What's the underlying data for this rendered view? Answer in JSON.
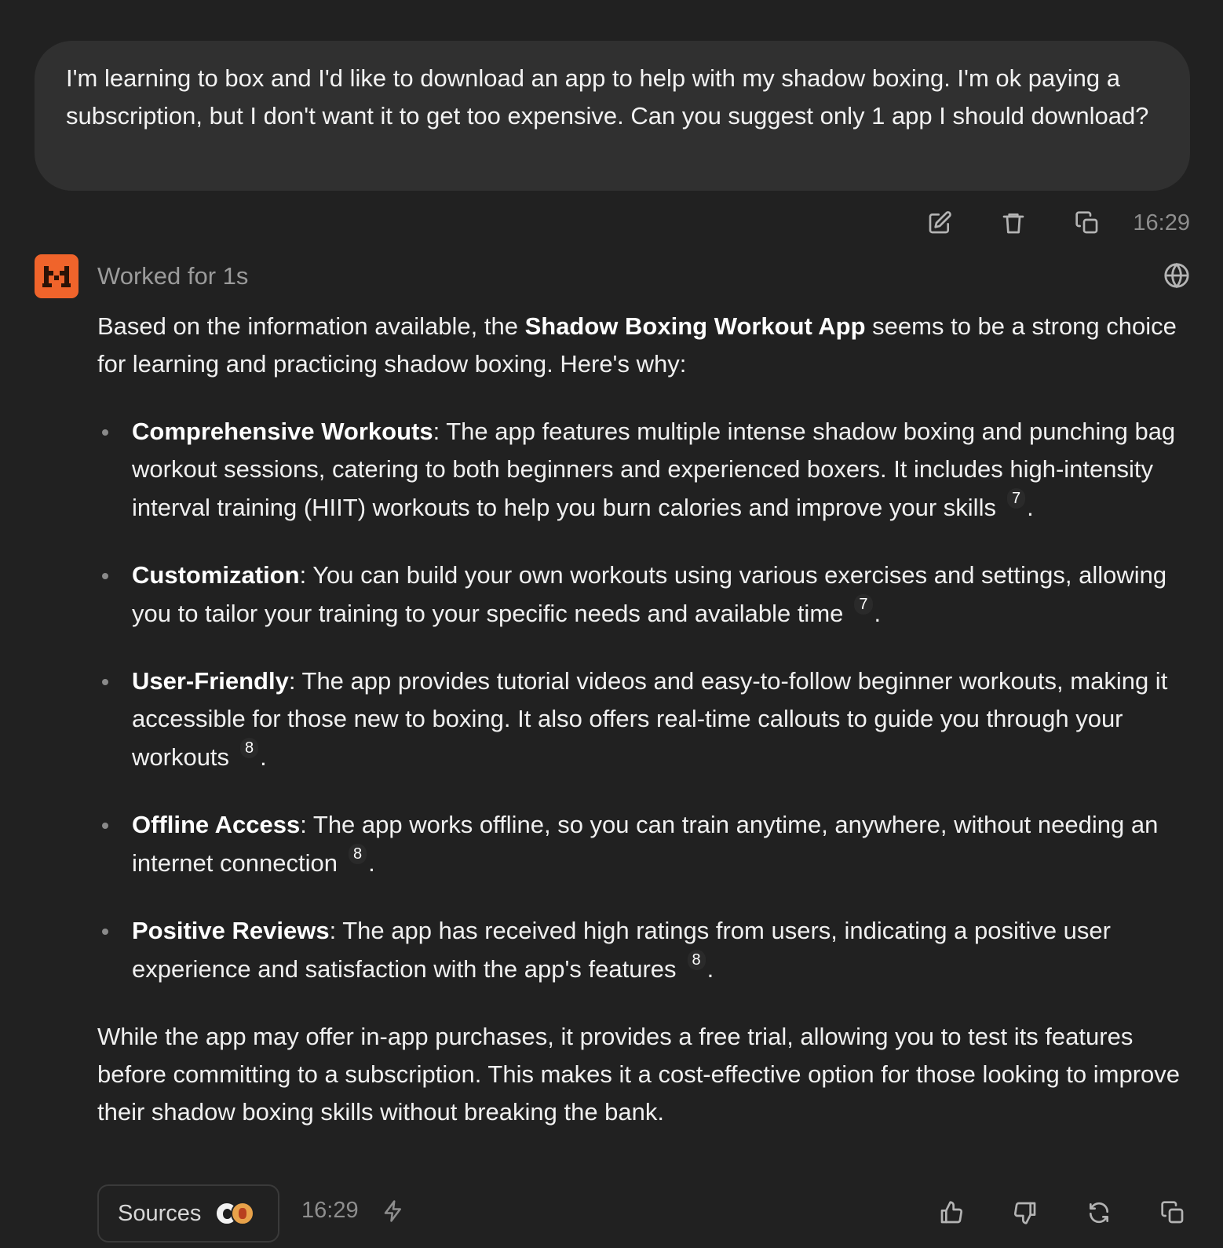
{
  "user_message": {
    "text": "I'm learning to box and I'd like to download an app to help with my shadow boxing. I'm ok paying a subscription, but I don't want it to get too expensive. Can you suggest only 1 app I should download?",
    "timestamp": "16:29",
    "actions": [
      "edit-icon",
      "trash-icon",
      "copy-icon"
    ]
  },
  "assistant": {
    "status": "Worked for 1s",
    "intro_before": "Based on the information available, the ",
    "intro_bold": "Shadow Boxing Workout App",
    "intro_after": " seems to be a strong choice for learning and practicing shadow boxing. Here's why:",
    "bullets": [
      {
        "title": "Comprehensive Workouts",
        "text": ": The app features multiple intense shadow boxing and punching bag workout sessions, catering to both beginners and experienced boxers. It includes high-intensity interval training (HIIT) workouts to help you burn calories and improve your skills",
        "cite": "7"
      },
      {
        "title": "Customization",
        "text": ": You can build your own workouts using various exercises and settings, allowing you to tailor your training to your specific needs and available time",
        "cite": "7"
      },
      {
        "title": "User-Friendly",
        "text": ": The app provides tutorial videos and easy-to-follow beginner workouts, making it accessible for those new to boxing. It also offers real-time callouts to guide you through your workouts",
        "cite": "8"
      },
      {
        "title": "Offline Access",
        "text": ": The app works offline, so you can train anytime, anywhere, without needing an internet connection",
        "cite": "8"
      },
      {
        "title": "Positive Reviews",
        "text": ": The app has received high ratings from users, indicating a positive user experience and satisfaction with the app's features",
        "cite": "8"
      }
    ],
    "period": ".",
    "conclusion": "While the app may offer in-app purchases, it provides a free trial, allowing you to test its features before committing to a subscription. This makes it a cost-effective option for those looking to improve their shadow boxing skills without breaking the bank.",
    "sources_label": "Sources",
    "timestamp": "16:29",
    "actions": [
      "thumbs-up-icon",
      "thumbs-down-icon",
      "regenerate-icon",
      "copy-icon"
    ]
  },
  "colors": {
    "background": "#212121",
    "user_bubble": "#303030",
    "avatar_accent": "#f0642b",
    "muted_text": "#8e8e8e"
  }
}
